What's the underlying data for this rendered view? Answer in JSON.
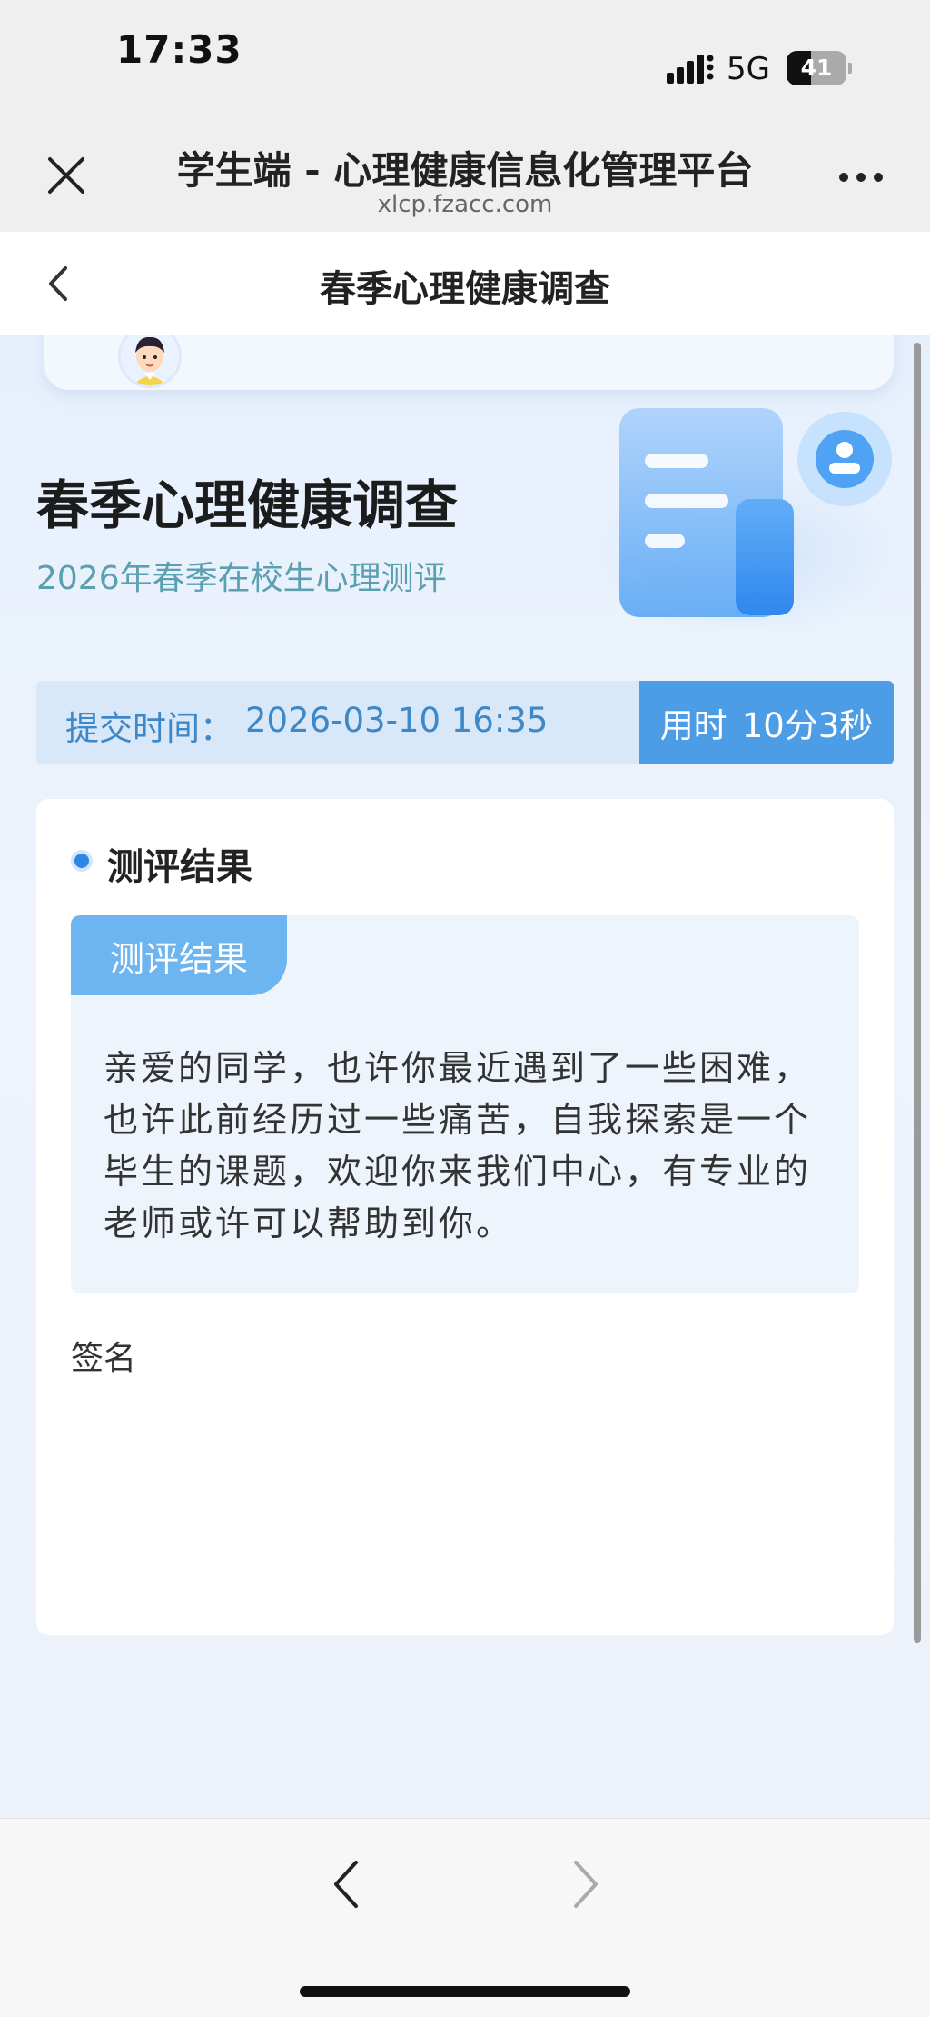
{
  "status_bar": {
    "time": "17:33",
    "network": "5G",
    "battery_text": "41",
    "battery_level": 0.41
  },
  "browser": {
    "title": "学生端 - 心理健康信息化管理平台",
    "url": "xlcp.fzacc.com",
    "close_icon": "close-icon",
    "more_icon": "more-icon"
  },
  "nav": {
    "title": "春季心理健康调查",
    "back_icon": "chevron-left-icon"
  },
  "survey": {
    "title": "春季心理健康调查",
    "subtitle": "2026年春季在校生心理测评"
  },
  "submission": {
    "time_label": "提交时间：",
    "time_value": "2026-03-10 16:35",
    "duration_label": "用时",
    "duration_value": "10分3秒"
  },
  "result": {
    "section_title": "测评结果",
    "tag": "测评结果",
    "text": "亲爱的同学，也许你最近遇到了一些困难，也许此前经历过一些痛苦，自我探索是一个毕生的课题，欢迎你来我们中心，有专业的老师或许可以帮助到你。",
    "signature_label": "签名"
  },
  "toolbar": {
    "back_icon": "chevron-left-icon",
    "forward_icon": "chevron-right-icon"
  },
  "colors": {
    "accent": "#4d9ce6",
    "tag": "#6cb5f0",
    "subtitle": "#5aa0b0"
  }
}
